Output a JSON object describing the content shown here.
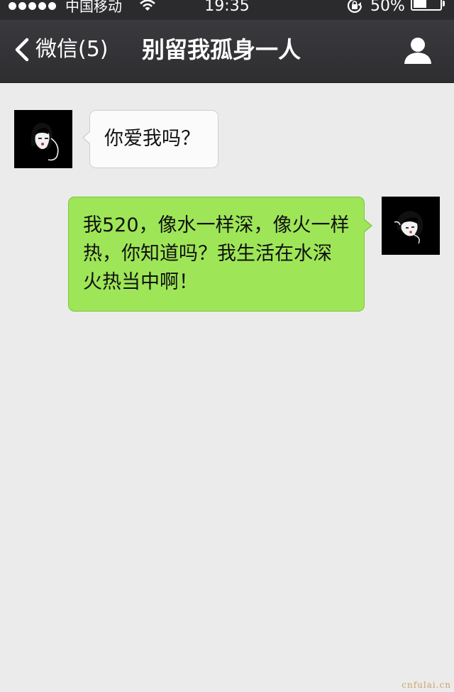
{
  "status_bar": {
    "carrier": "中国移动",
    "time": "19:35",
    "battery_percent": "50%",
    "battery_level": 0.5,
    "signal_dots": 5
  },
  "nav": {
    "back_label": "微信(5)",
    "title": "别留我孤身一人"
  },
  "messages": [
    {
      "direction": "incoming",
      "text": "你爱我吗？"
    },
    {
      "direction": "outgoing",
      "text": "我520，像水一样深，像火一样热，你知道吗？我生活在水深火热当中啊！"
    }
  ],
  "watermark": "cnfulai.cn",
  "colors": {
    "nav_bg": "#333336",
    "chat_bg": "#ebebeb",
    "outgoing_bubble": "#9ee657",
    "incoming_bubble": "#fbfbfb"
  }
}
